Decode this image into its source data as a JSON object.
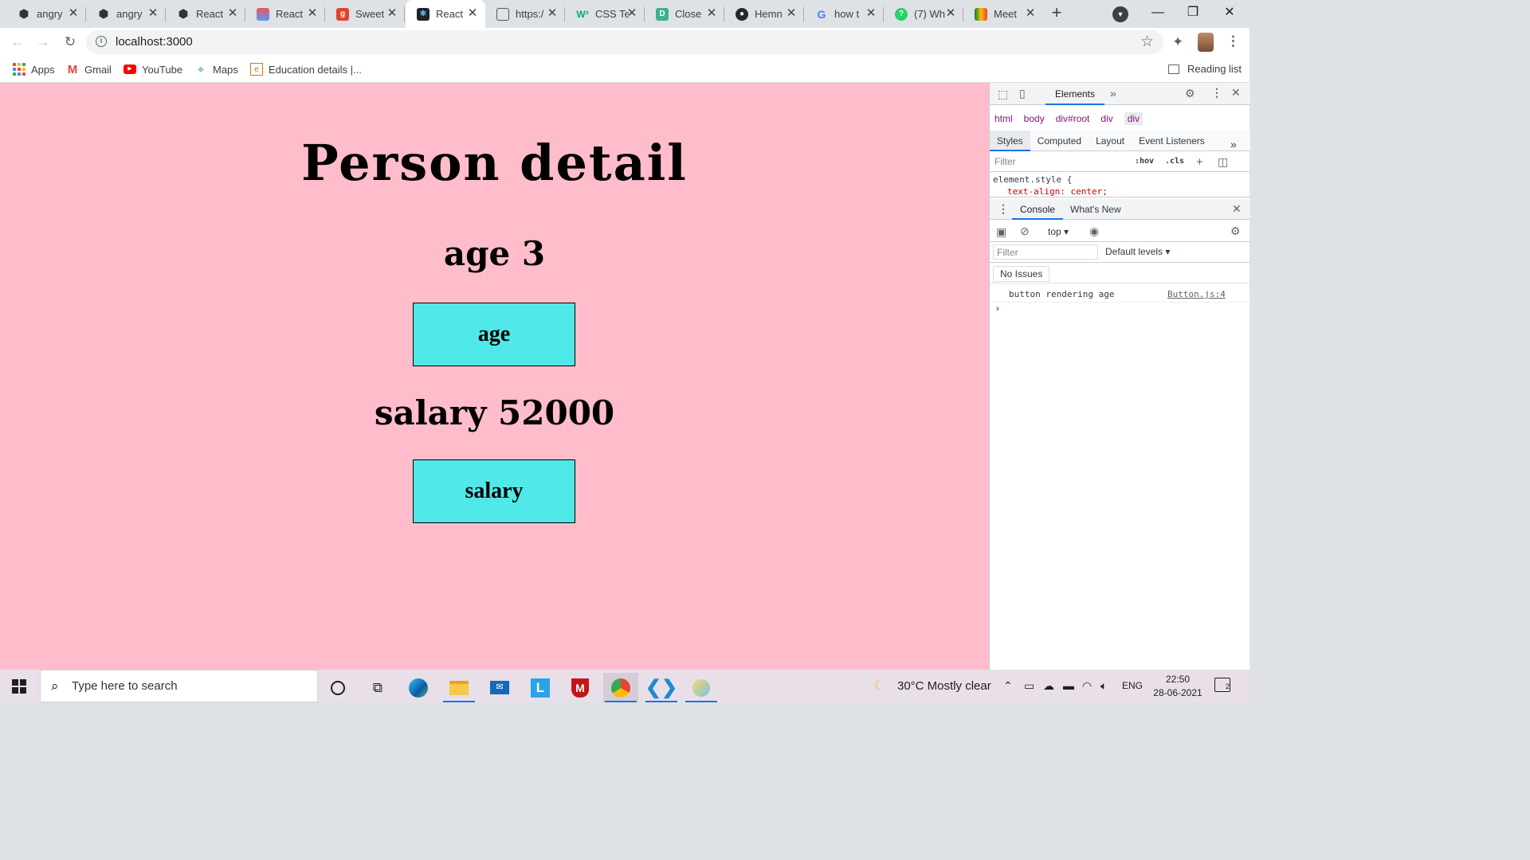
{
  "browser": {
    "tabs": [
      {
        "title": "angry",
        "icon": "codesandbox-icon",
        "active": false
      },
      {
        "title": "angry",
        "icon": "codesandbox-icon",
        "active": false
      },
      {
        "title": "React",
        "icon": "codesandbox-icon",
        "active": false
      },
      {
        "title": "React",
        "icon": "stackblitz-icon",
        "active": false
      },
      {
        "title": "Sweet",
        "icon": "g-logo-icon",
        "active": false
      },
      {
        "title": "React",
        "icon": "react-icon",
        "active": true
      },
      {
        "title": "https:/",
        "icon": "page-icon",
        "active": false
      },
      {
        "title": "CSS Te",
        "icon": "w3-icon",
        "active": false
      },
      {
        "title": "Close",
        "icon": "docs-icon",
        "active": false
      },
      {
        "title": "Hemn",
        "icon": "github-icon",
        "active": false
      },
      {
        "title": "how t",
        "icon": "google-icon",
        "active": false
      },
      {
        "title": "(7) Wh",
        "icon": "whatsapp-icon",
        "active": false
      },
      {
        "title": "Meet",
        "icon": "meet-icon",
        "active": false
      }
    ],
    "url": "localhost:3000",
    "bookmarks": [
      {
        "label": "Apps",
        "icon": "apps-grid-icon"
      },
      {
        "label": "Gmail",
        "icon": "gmail-icon"
      },
      {
        "label": "YouTube",
        "icon": "youtube-icon"
      },
      {
        "label": "Maps",
        "icon": "maps-icon"
      },
      {
        "label": "Education details |...",
        "icon": "edu-icon"
      }
    ],
    "reading_list": "Reading list"
  },
  "page": {
    "title": "Person detail",
    "age_line": "age 3",
    "age_button": "age",
    "salary_line": "salary 52000",
    "salary_button": "salary",
    "background": "#ffbdcb",
    "button_color": "#50e8e8"
  },
  "devtools": {
    "top_tab": "Elements",
    "breadcrumbs": [
      "html",
      "body",
      "div#root",
      "div",
      "div"
    ],
    "subtabs": [
      "Styles",
      "Computed",
      "Layout",
      "Event Listeners"
    ],
    "styles_filter_placeholder": "Filter",
    "hov": ":hov",
    "cls": ".cls",
    "code_line1": "element.style {",
    "code_line2": "text-align: center;",
    "drawer_tabs": [
      "Console",
      "What's New"
    ],
    "context": "top",
    "console_filter_placeholder": "Filter",
    "levels": "Default levels",
    "issues": "No Issues",
    "log_message": "button rendering age",
    "log_source": "Button.js:4",
    "prompt": "›"
  },
  "taskbar": {
    "search_placeholder": "Type here to search",
    "weather": "30°C  Mostly clear",
    "language": "ENG",
    "time": "22:50",
    "date": "28-06-2021",
    "notifications": "2"
  }
}
